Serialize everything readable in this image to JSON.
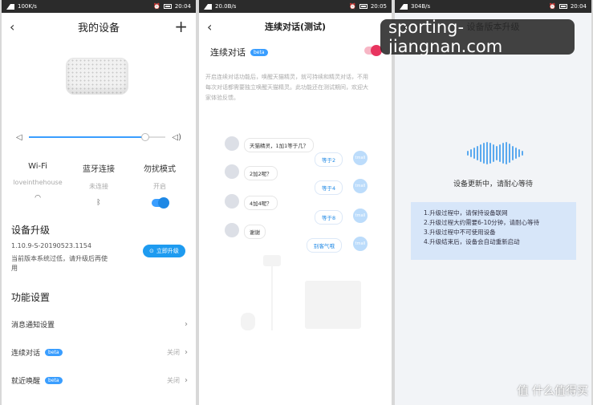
{
  "left": {
    "status": {
      "net": "100K/s",
      "time": "20:04"
    },
    "title": "我的设备",
    "cols": [
      {
        "title": "Wi-Fi",
        "value": "loveinthehouse"
      },
      {
        "title": "蓝牙连接",
        "value": "未连接"
      },
      {
        "title": "勿扰模式",
        "value": "开启"
      }
    ],
    "volume": 0.85,
    "upgrade": {
      "heading": "设备升级",
      "version": "1.10.9-S-20190523.1154",
      "note_line1": "当前版本系统过低，请升级后再使",
      "note_line2": "用",
      "button": "立即升级"
    },
    "features": {
      "heading": "功能设置",
      "rows": [
        {
          "label": "消息通知设置",
          "badge": "",
          "value": ""
        },
        {
          "label": "连续对话",
          "badge": "beta",
          "value": "关闭"
        },
        {
          "label": "就近唤醒",
          "badge": "beta",
          "value": "关闭"
        }
      ]
    }
  },
  "middle": {
    "status": {
      "net": "20.0B/s",
      "time": "20:05"
    },
    "title": "连续对话(测试)",
    "toggle_label": "连续对话",
    "badge": "beta",
    "desc_line1": "开启连续对话功能后，唤醒天猫精灵，就可持续和精灵对话，不用",
    "desc_line2": "每次对话都需要独立唤醒天猫精灵。此功能还在测试期间，欢迎大",
    "desc_line3": "家体验反馈。",
    "chat": [
      {
        "q": "天猫精灵，1加1等于几？",
        "a": "等于2"
      },
      {
        "q": "2加2呢？",
        "a": "等于4"
      },
      {
        "q": "4加4呢？",
        "a": "等于8"
      },
      {
        "q": "谢谢",
        "a": "别客气哦"
      }
    ]
  },
  "right": {
    "status": {
      "net": "304B/s",
      "time": "20:04"
    },
    "title": "设备版本升级",
    "updating": "设备更新中，请耐心等待",
    "tips": [
      "1.升级过程中，请保持设备联网",
      "2.升级过程大约需要6-10分钟，请耐心等待",
      "3.升级过程中不可使用设备",
      "4.升级结束后，设备会自动重新启动"
    ]
  },
  "watermark": "sporting-jiangnan.com",
  "logo": "值 什么值得买"
}
